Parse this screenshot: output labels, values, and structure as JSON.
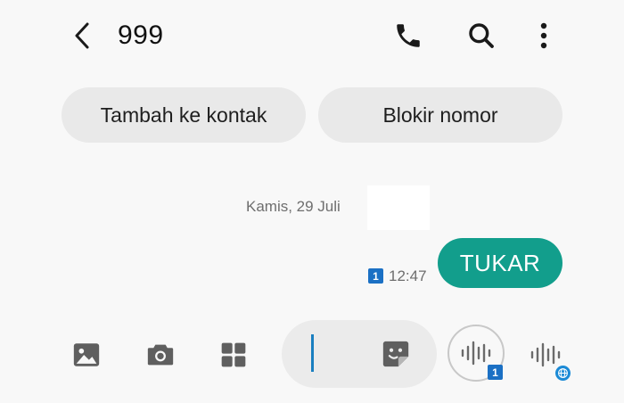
{
  "header": {
    "title": "999",
    "back_icon": "chevron-left-icon",
    "call_icon": "phone-icon",
    "search_icon": "search-icon",
    "more_icon": "more-vertical-icon"
  },
  "actions": {
    "add_contact_label": "Tambah ke kontak",
    "block_number_label": "Blokir nomor"
  },
  "conversation": {
    "date_label": "Kamis, 29 Juli",
    "messages": [
      {
        "text": "TUKAR",
        "time": "12:47",
        "sim": "1",
        "direction": "outgoing"
      }
    ]
  },
  "composer": {
    "gallery_icon": "image-icon",
    "camera_icon": "camera-icon",
    "apps_icon": "grid-icon",
    "sticker_icon": "sticker-icon",
    "voice_icon": "voice-wave-icon",
    "voice_sim": "1",
    "voice_alt_icon": "voice-wave-globe-icon"
  },
  "colors": {
    "background": "#f8f8f8",
    "bubble": "#129e8c",
    "sim_badge": "#1b70c4",
    "pill": "#e9e9e9",
    "caret": "#1a7fc0"
  }
}
